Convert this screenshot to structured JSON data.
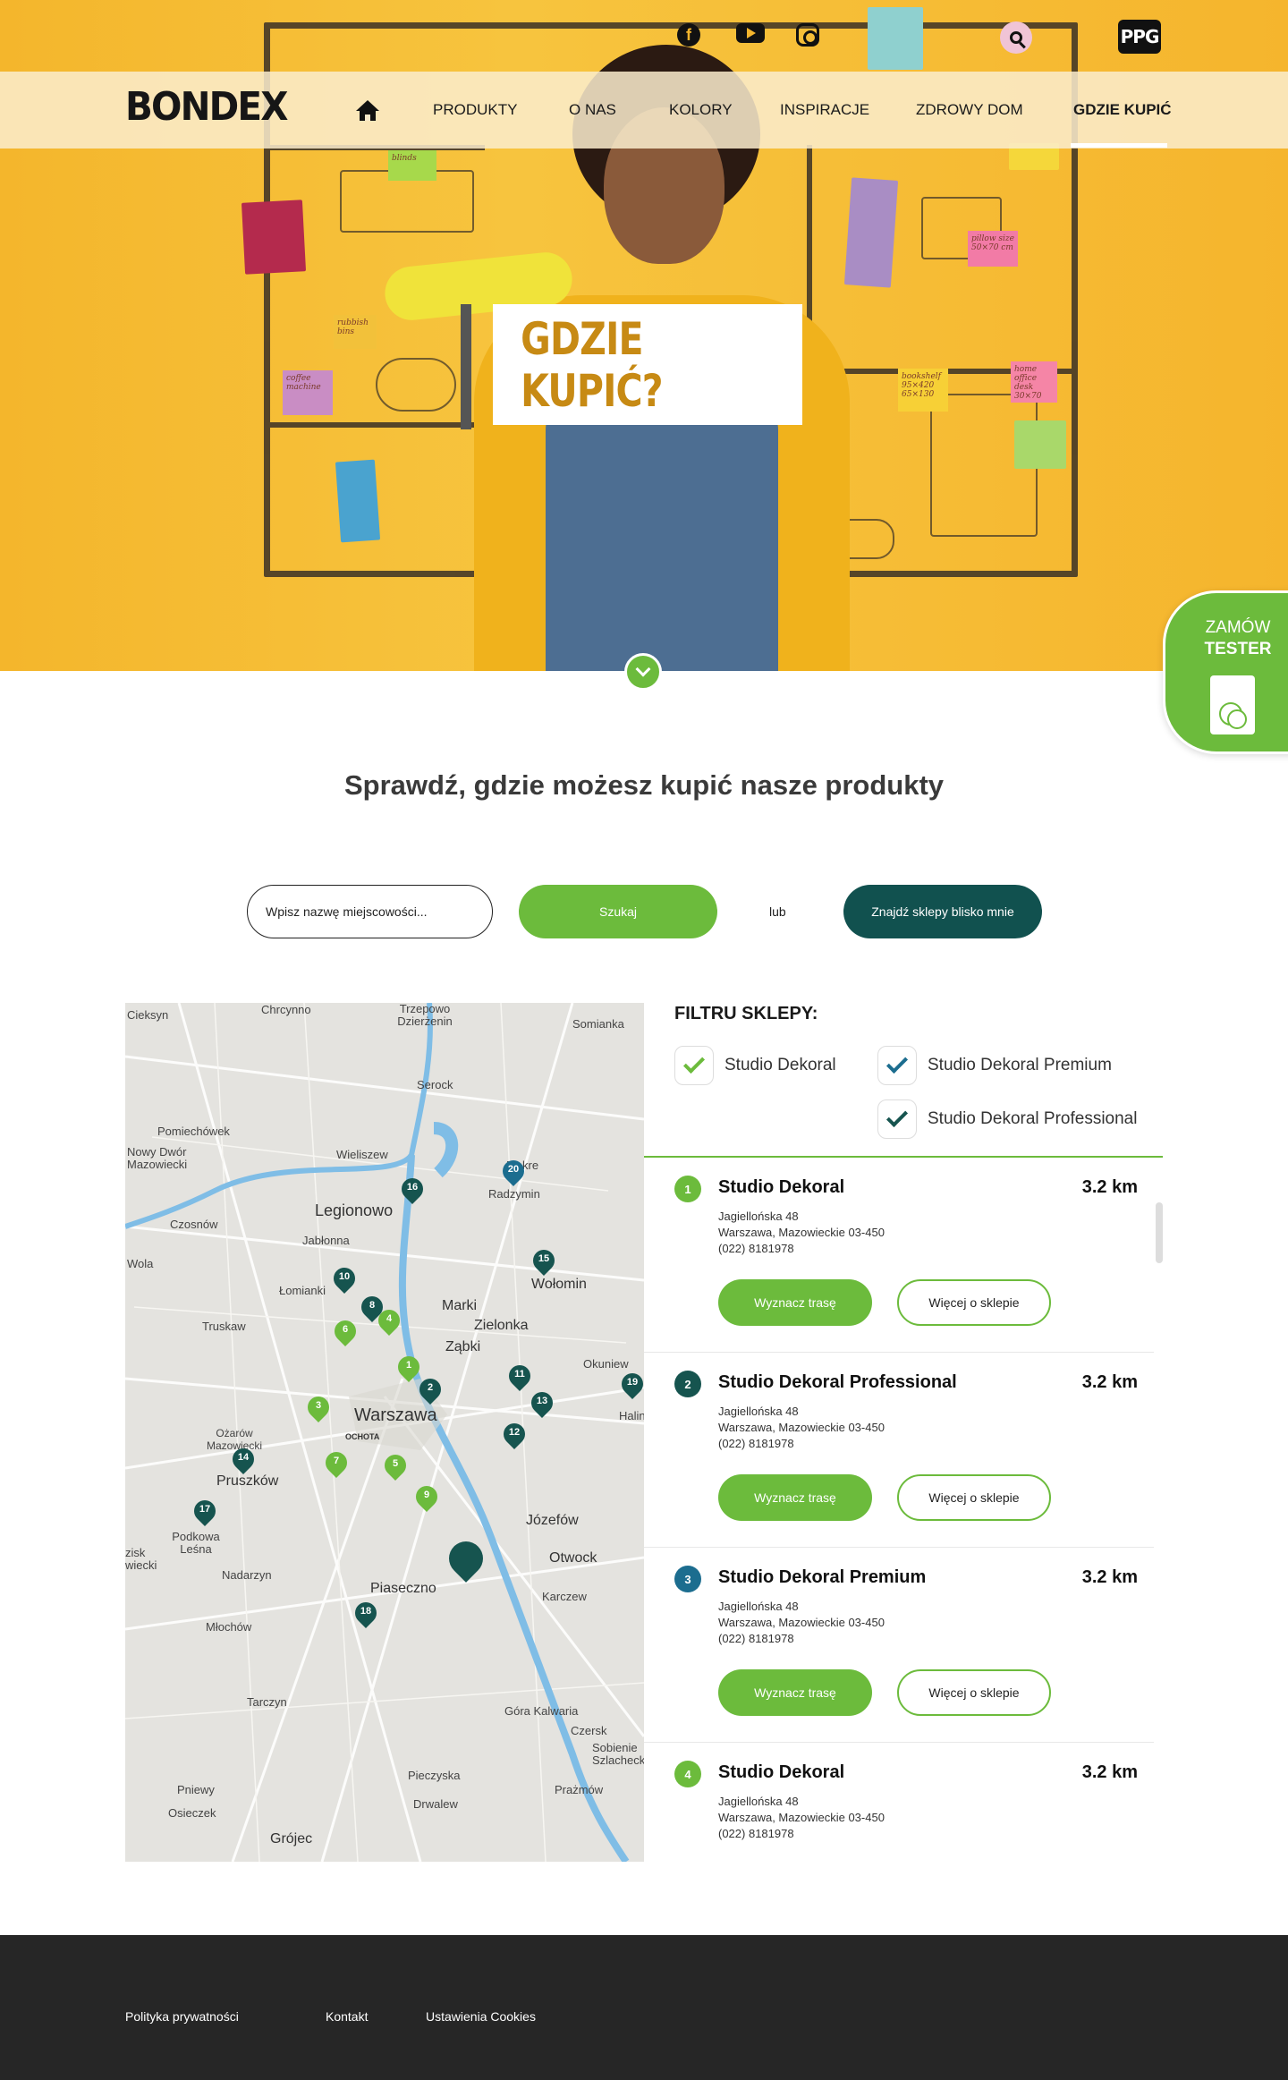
{
  "header": {
    "brand": "BONDEX",
    "ppg_logo": "PPG",
    "social": [
      "facebook-icon",
      "youtube-icon",
      "instagram-icon"
    ],
    "search_icon": "search-icon",
    "nav": [
      {
        "label": "PRODUKTY"
      },
      {
        "label": "O NAS"
      },
      {
        "label": "KOLORY"
      },
      {
        "label": "INSPIRACJE"
      },
      {
        "label": "ZDROWY DOM"
      },
      {
        "label": "GDZIE KUPIĆ",
        "active": true
      }
    ]
  },
  "hero": {
    "title": "GDZIE KUPIĆ?",
    "notes": [
      "blinds",
      "rubbish bins",
      "coffee machine",
      "pillow size 50×70 cm",
      "bookshelf 95×420 65×130",
      "home office desk 30×70"
    ]
  },
  "tester": {
    "line1": "ZAMÓW",
    "line2": "TESTER"
  },
  "section": {
    "title": "Sprawdź, gdzie możesz kupić nasze produkty",
    "input_placeholder": "Wpisz nazwę miejscowości...",
    "search_label": "Szukaj",
    "or_label": "lub",
    "near_label": "Znajdź sklepy blisko mnie"
  },
  "map": {
    "labels": [
      "Cieksyn",
      "Chrcynno",
      "Trzepowo Dzierżenin",
      "Somianka",
      "Serock",
      "Pomiechówek",
      "Nowy Dwór Mazowiecki",
      "Wieliszew",
      "Mokre",
      "Radzymin",
      "Legionowo",
      "Czosnów",
      "Jabłonna",
      "Wola",
      "Łomianki",
      "Wołomin",
      "Marki",
      "Zielonka",
      "Truskaw",
      "Ząbki",
      "Okuniew",
      "Halin",
      "Warszawa",
      "OCHOTA",
      "Ożarów Mazowiecki",
      "Pruszków",
      "Józefów",
      "Podkowa Leśna",
      "zisk wiecki",
      "Nadarzyn",
      "Otwock",
      "Piaseczno",
      "Karczew",
      "Młochów",
      "Tarczyn",
      "Góra Kalwaria",
      "Czersk",
      "Sobienie Szlacheckie",
      "Pieczyska",
      "Prażmów",
      "Drwalew",
      "Pniewy",
      "Osieczek",
      "Grójec"
    ],
    "pins": [
      {
        "n": "1",
        "color": "green"
      },
      {
        "n": "2",
        "color": "dark"
      },
      {
        "n": "3",
        "color": "green"
      },
      {
        "n": "4",
        "color": "green"
      },
      {
        "n": "5",
        "color": "green"
      },
      {
        "n": "6",
        "color": "green"
      },
      {
        "n": "7",
        "color": "green"
      },
      {
        "n": "8",
        "color": "dark"
      },
      {
        "n": "9",
        "color": "green"
      },
      {
        "n": "10",
        "color": "dark"
      },
      {
        "n": "11",
        "color": "dark"
      },
      {
        "n": "12",
        "color": "dark"
      },
      {
        "n": "13",
        "color": "dark"
      },
      {
        "n": "14",
        "color": "dark"
      },
      {
        "n": "15",
        "color": "dark"
      },
      {
        "n": "16",
        "color": "dark"
      },
      {
        "n": "17",
        "color": "dark"
      },
      {
        "n": "18",
        "color": "dark"
      },
      {
        "n": "19",
        "color": "dark"
      },
      {
        "n": "20",
        "color": "blue"
      }
    ]
  },
  "filters": {
    "title": "FILTRU SKLEPY:",
    "items": [
      {
        "label": "Studio Dekoral",
        "tick_color": "#6cbb3c"
      },
      {
        "label": "Studio Dekoral Premium",
        "tick_color": "#1c6d8f"
      },
      {
        "label": "Studio Dekoral Professional",
        "tick_color": "#16544f"
      }
    ]
  },
  "stores": [
    {
      "n": "1",
      "badge_color": "#6cbb3c",
      "name": "Studio Dekoral",
      "dist": "3.2 km",
      "street": "Jagiellońska 48",
      "city": "Warszawa, Mazowieckie 03-450",
      "phone": "(022) 8181978",
      "route": "Wyznacz trasę",
      "more": "Więcej o sklepie"
    },
    {
      "n": "2",
      "badge_color": "#16544f",
      "name": "Studio Dekoral Professional",
      "dist": "3.2 km",
      "street": "Jagiellońska 48",
      "city": "Warszawa, Mazowieckie 03-450",
      "phone": "(022) 8181978",
      "route": "Wyznacz trasę",
      "more": "Więcej o sklepie"
    },
    {
      "n": "3",
      "badge_color": "#1c6d8f",
      "name": "Studio Dekoral Premium",
      "dist": "3.2 km",
      "street": "Jagiellońska 48",
      "city": "Warszawa, Mazowieckie 03-450",
      "phone": "(022) 8181978",
      "route": "Wyznacz trasę",
      "more": "Więcej o sklepie"
    },
    {
      "n": "4",
      "badge_color": "#6cbb3c",
      "name": "Studio Dekoral",
      "dist": "3.2 km",
      "street": "Jagiellońska 48",
      "city": "Warszawa, Mazowieckie 03-450",
      "phone": "(022) 8181978",
      "route": "Wyznacz trasę",
      "more": "Więcej o sklepie"
    }
  ],
  "footer": {
    "links": [
      "Polityka prywatności",
      "Kontakt",
      "Ustawienia Cookies"
    ]
  },
  "colors": {
    "green": "#6cbb3c",
    "dark_teal": "#16544f",
    "blue": "#1c6d8f",
    "hero_yellow": "#f5b52d",
    "footer": "#262626"
  }
}
